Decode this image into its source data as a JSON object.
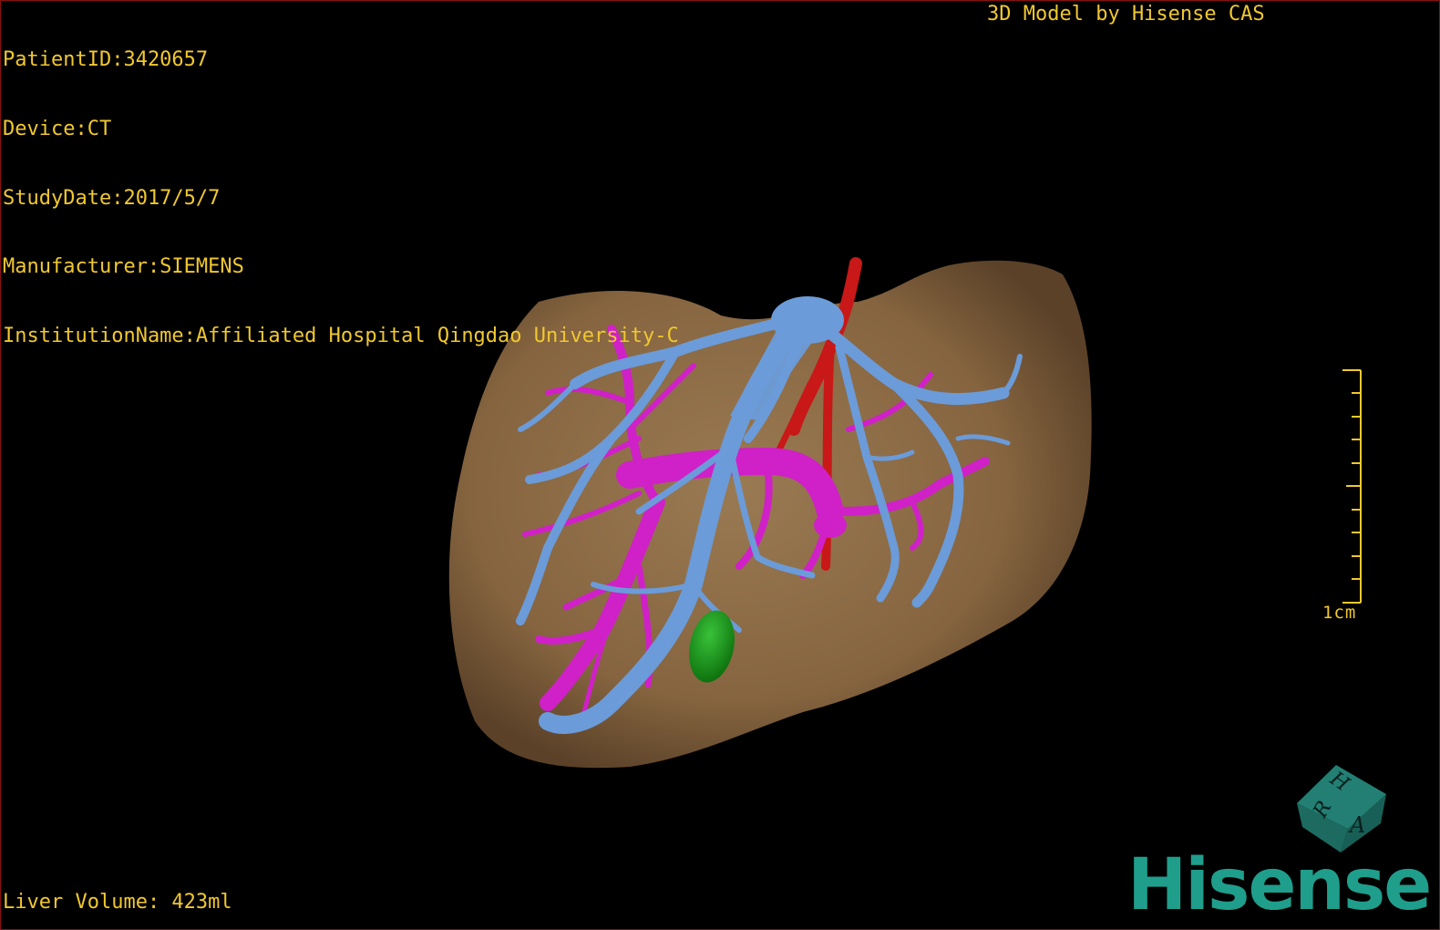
{
  "overlay": {
    "patient_id": "PatientID:3420657",
    "device": "Device:CT",
    "study_date": "StudyDate:2017/5/7",
    "manufacturer": "Manufacturer:SIEMENS",
    "institution": "InstitutionName:Affiliated Hospital Qingdao University-C",
    "model_credit": "3D Model by Hisense CAS",
    "liver_volume": "Liver Volume: 423ml"
  },
  "scale_bar": {
    "label": "1cm"
  },
  "orientation_cube": {
    "faces": [
      "H",
      "A",
      "R"
    ],
    "color": "#1f7f74"
  },
  "brand": {
    "logo_text": "Hisense",
    "color": "#1f9e8c"
  },
  "colors": {
    "overlay_text": "#f0c830",
    "liver": "#8b6a46",
    "portal_vein": "#6b9bd9",
    "hepatic_vein": "#d020c8",
    "artery": "#c81818",
    "lesion": "#1a9a1a",
    "border": "#8a1010"
  }
}
